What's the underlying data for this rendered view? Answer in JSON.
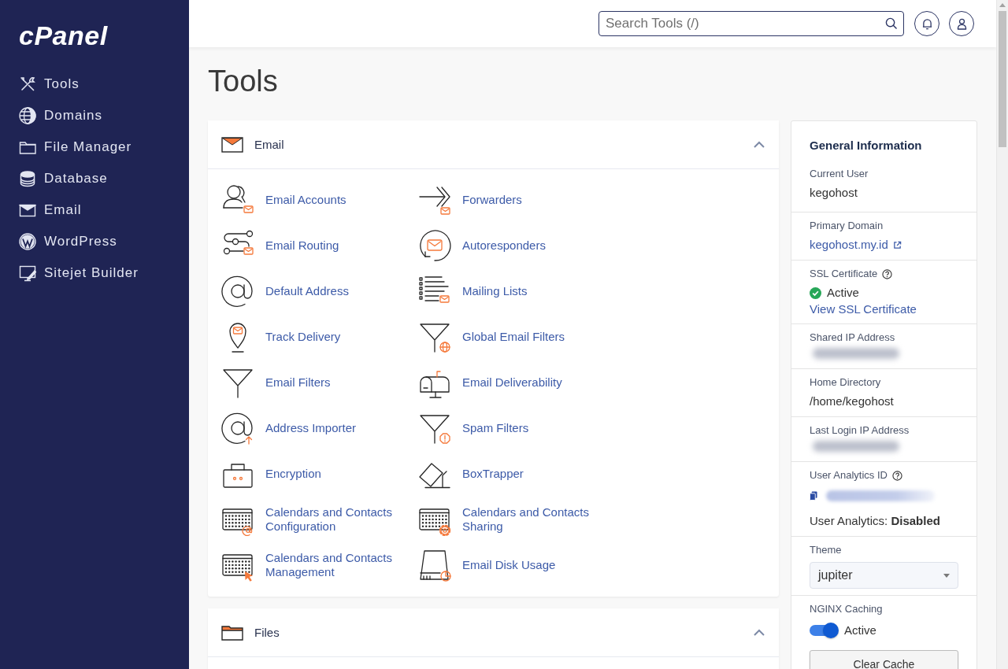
{
  "sidebar": {
    "logo": "cPanel",
    "items": [
      {
        "label": "Tools"
      },
      {
        "label": "Domains"
      },
      {
        "label": "File Manager"
      },
      {
        "label": "Database"
      },
      {
        "label": "Email"
      },
      {
        "label": "WordPress"
      },
      {
        "label": "Sitejet Builder"
      }
    ]
  },
  "top_bar": {
    "search": {
      "placeholder": "Search Tools (/)"
    }
  },
  "title": "Tools",
  "sections": [
    {
      "title": "Email",
      "expanded": true,
      "tools": [
        {
          "label": "Email Accounts"
        },
        {
          "label": "Forwarders"
        },
        {
          "label": "Email Routing"
        },
        {
          "label": "Autoresponders"
        },
        {
          "label": "Default Address"
        },
        {
          "label": "Mailing Lists"
        },
        {
          "label": "Track Delivery"
        },
        {
          "label": "Global Email Filters"
        },
        {
          "label": "Email Filters"
        },
        {
          "label": "Email Deliverability"
        },
        {
          "label": "Address Importer"
        },
        {
          "label": "Spam Filters"
        },
        {
          "label": "Encryption"
        },
        {
          "label": "BoxTrapper"
        },
        {
          "label": "Calendars and Contacts Configuration"
        },
        {
          "label": "Calendars and Contacts Sharing"
        },
        {
          "label": "Calendars and Contacts Management"
        },
        {
          "label": "Email Disk Usage"
        }
      ]
    },
    {
      "title": "Files",
      "expanded": true
    }
  ],
  "general_information": {
    "title": "General Information",
    "fields": [
      {
        "kind": "text",
        "label": "Current User",
        "value": "kegohost"
      },
      {
        "kind": "link",
        "label": "Primary Domain",
        "value": "kegohost.my.id"
      },
      {
        "kind": "status",
        "label": "SSL Certificate",
        "help": true,
        "status": "Active",
        "link": "View SSL Certificate"
      },
      {
        "kind": "redacted",
        "label": "Shared IP Address"
      },
      {
        "kind": "text",
        "label": "Home Directory",
        "value": "/home/kegohost"
      },
      {
        "kind": "redacted",
        "label": "Last Login IP Address"
      },
      {
        "kind": "analytics",
        "label": "User Analytics ID",
        "help": true,
        "note": "User Analytics: **Disabled**"
      },
      {
        "kind": "select",
        "label": "Theme",
        "value": "jupiter"
      },
      {
        "kind": "toggle",
        "label": "NGINX Caching",
        "on": true,
        "status": "Active",
        "button": "Clear Cache"
      }
    ]
  }
}
